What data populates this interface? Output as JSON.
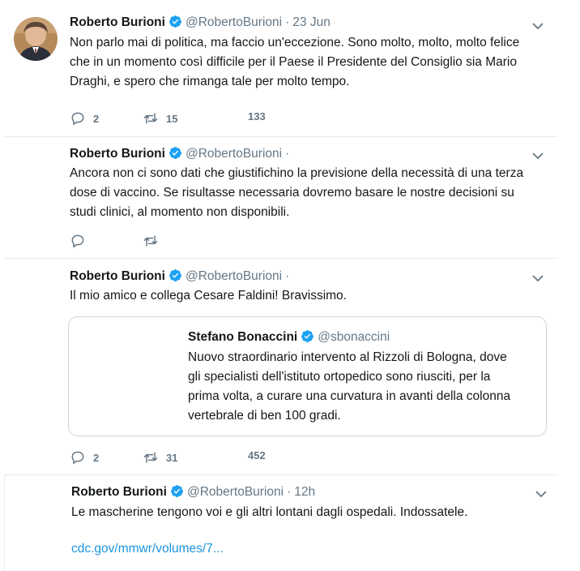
{
  "colors": {
    "accent": "#1da1f2",
    "link": "#1b95e0",
    "muted": "#657786",
    "border": "#e6ecf0"
  },
  "tweets": [
    {
      "name": "Roberto Burioni",
      "handle": "@RobertoBurioni",
      "dot": "·",
      "time": "23 Jun",
      "lines": [
        "Non parlo mai di politica, ma faccio un'eccezione. Sono molto, molto, molto felice",
        "che in un momento così difficile per il Paese il Presidente del Consiglio sia Mario",
        "Draghi, e spero che rimanga tale per molto tempo."
      ],
      "replies": "2",
      "retweets": "15",
      "likes": "133"
    },
    {
      "name": "Roberto Burioni",
      "handle": "@RobertoBurioni",
      "dot": "·",
      "lines": [
        "Ancora non ci sono dati che giustifichino la previsione della necessità di una terza",
        "dose di vaccino. Se risultasse necessaria dovremo basare le nostre decisioni su",
        "studi clinici, al momento non disponibili."
      ]
    },
    {
      "name": "Roberto Burioni",
      "handle": "@RobertoBurioni",
      "dot": "·",
      "lines": [
        "Il mio amico e collega Cesare Faldini! Bravissimo."
      ],
      "quote": {
        "name": "Stefano Bonaccini",
        "handle": "@sbonaccini",
        "lines": [
          "Nuovo straordinario intervento al Rizzoli di Bologna, dove",
          "gli specialisti dell'istituto ortopedico sono riusciti, per la",
          "prima volta, a curare una curvatura in avanti della colonna",
          "vertebrale di ben 100 gradi."
        ]
      },
      "replies": "2",
      "retweets": "31",
      "likes": "452"
    },
    {
      "name": "Roberto Burioni",
      "handle": "@RobertoBurioni",
      "dot": "·",
      "time": "12h",
      "lines": [
        "Le mascherine tengono voi e gli altri lontani dagli ospedali. Indossatele."
      ],
      "link": "cdc.gov/mmwr/volumes/7..."
    }
  ]
}
